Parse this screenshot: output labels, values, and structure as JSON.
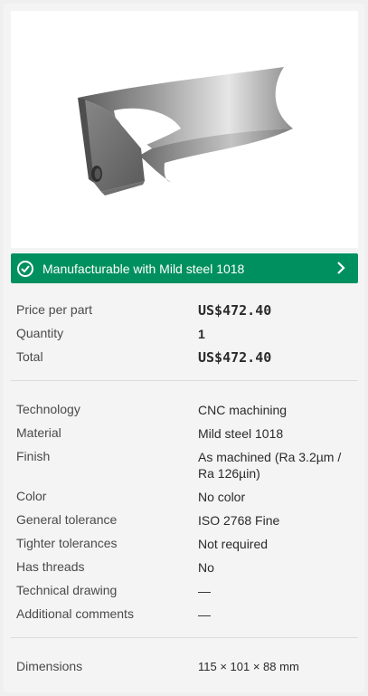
{
  "status": {
    "message": "Manufacturable with Mild steel 1018"
  },
  "pricing": [
    {
      "label": "Price per part",
      "value": "US$472.40"
    },
    {
      "label": "Quantity",
      "value": "1"
    },
    {
      "label": "Total",
      "value": "US$472.40"
    }
  ],
  "specs": [
    {
      "label": "Technology",
      "value": "CNC machining"
    },
    {
      "label": "Material",
      "value": "Mild steel 1018"
    },
    {
      "label": "Finish",
      "value": "As machined (Ra 3.2µm / Ra 126µin)"
    },
    {
      "label": "Color",
      "value": "No color"
    },
    {
      "label": "General tolerance",
      "value": "ISO 2768 Fine"
    },
    {
      "label": "Tighter tolerances",
      "value": "Not required"
    },
    {
      "label": "Has threads",
      "value": "No"
    },
    {
      "label": "Technical drawing",
      "value": "—"
    },
    {
      "label": "Additional comments",
      "value": "—"
    }
  ],
  "dimensions": {
    "label": "Dimensions",
    "value": "115 × 101 × 88 mm"
  },
  "colors": {
    "success": "#00905f",
    "panel": "#f4f4f4"
  }
}
